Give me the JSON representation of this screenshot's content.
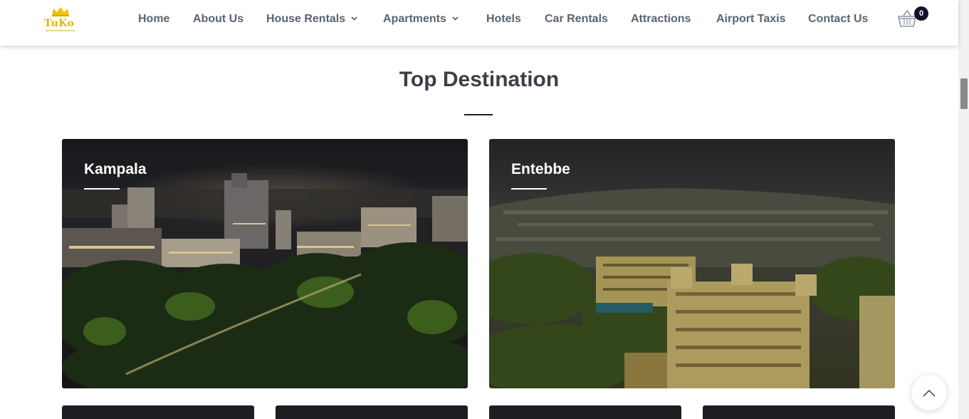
{
  "brand": {
    "name": "TuKo",
    "color": "#e8b400"
  },
  "nav": {
    "items": [
      {
        "label": "Home",
        "dropdown": false
      },
      {
        "label": "About Us",
        "dropdown": false
      },
      {
        "label": "House Rentals",
        "dropdown": true
      },
      {
        "label": "Apartments",
        "dropdown": true
      },
      {
        "label": "Hotels",
        "dropdown": false
      },
      {
        "label": "Car Rentals",
        "dropdown": false
      },
      {
        "label": "Attractions",
        "dropdown": false
      },
      {
        "label": "Airport Taxis",
        "dropdown": false
      },
      {
        "label": "Contact Us",
        "dropdown": false
      }
    ],
    "cart": {
      "icon": "basket-icon",
      "count": "0"
    }
  },
  "section": {
    "title": "Top Destination"
  },
  "destinations": [
    {
      "name": "Kampala"
    },
    {
      "name": "Entebbe"
    }
  ],
  "more_destinations_visible": 4,
  "back_to_top_icon": "chevron-up-icon",
  "colors": {
    "nav_text": "#5a6470",
    "title": "#3a3f48",
    "badge": "#15102a"
  }
}
